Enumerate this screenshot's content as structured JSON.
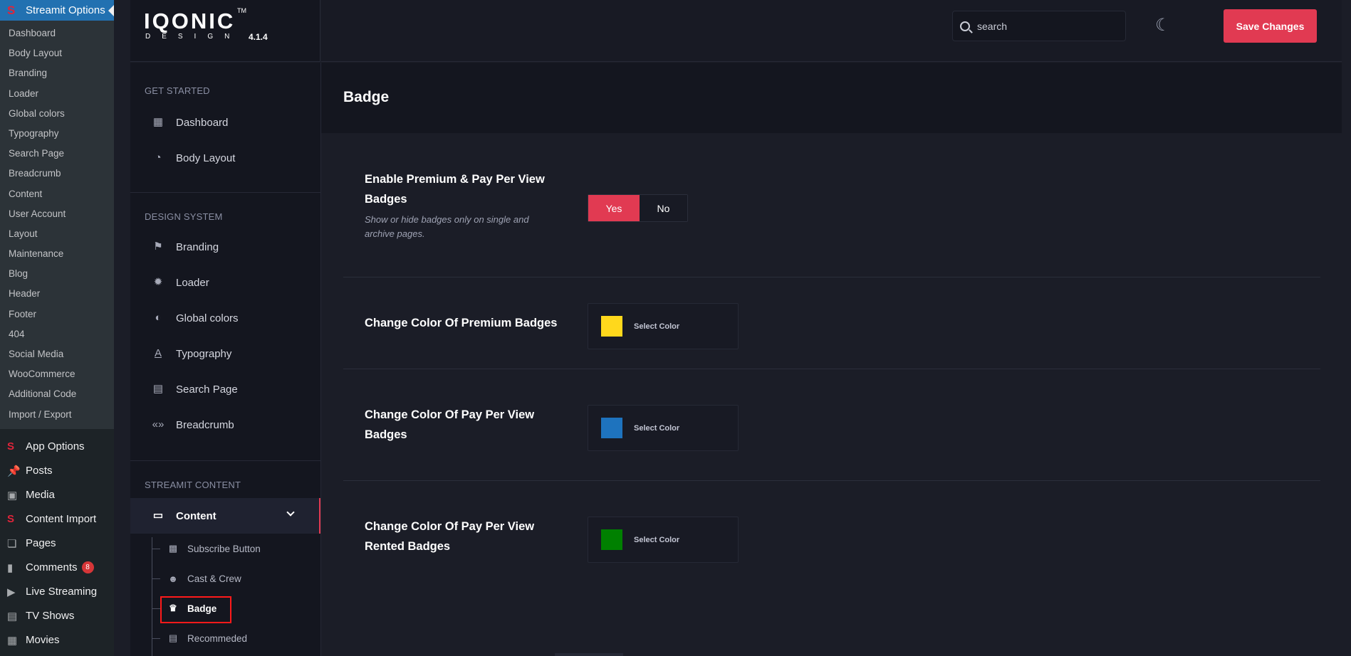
{
  "wp_menu": {
    "active_item": "Streamit Options",
    "submenu": [
      "Dashboard",
      "Body Layout",
      "Branding",
      "Loader",
      "Global colors",
      "Typography",
      "Search Page",
      "Breadcrumb",
      "Content",
      "User Account",
      "Layout",
      "Maintenance",
      "Blog",
      "Header",
      "Footer",
      "404",
      "Social Media",
      "WooCommerce",
      "Additional Code",
      "Import / Export"
    ],
    "top_items": [
      {
        "label": "App Options",
        "icon": "streamit-s-icon"
      },
      {
        "label": "Posts",
        "icon": "pin-icon"
      },
      {
        "label": "Media",
        "icon": "media-icon"
      },
      {
        "label": "Content Import",
        "icon": "streamit-s-icon"
      },
      {
        "label": "Pages",
        "icon": "pages-icon"
      },
      {
        "label": "Comments",
        "icon": "comment-icon",
        "badge": "8"
      },
      {
        "label": "Live Streaming",
        "icon": "play-icon"
      },
      {
        "label": "TV Shows",
        "icon": "tv-icon"
      },
      {
        "label": "Movies",
        "icon": "film-icon"
      }
    ]
  },
  "logo": {
    "main": "IQONIC",
    "tm": "TM",
    "sub": "DESIGN",
    "version": "4.1.4"
  },
  "topbar": {
    "search_placeholder": "search",
    "save_label": "Save Changes"
  },
  "panel_nav": {
    "sections": [
      {
        "title": "GET STARTED",
        "items": [
          {
            "label": "Dashboard",
            "icon": "grid-icon"
          },
          {
            "label": "Body Layout",
            "icon": "gauge-icon"
          }
        ]
      },
      {
        "title": "DESIGN SYSTEM",
        "items": [
          {
            "label": "Branding",
            "icon": "flag-icon"
          },
          {
            "label": "Loader",
            "icon": "loader-icon"
          },
          {
            "label": "Global colors",
            "icon": "droplet-icon"
          },
          {
            "label": "Typography",
            "icon": "typography-icon"
          },
          {
            "label": "Search Page",
            "icon": "document-icon"
          },
          {
            "label": "Breadcrumb",
            "icon": "breadcrumb-icon"
          }
        ]
      },
      {
        "title": "STREAMIT CONTENT",
        "items": [
          {
            "label": "Content",
            "icon": "window-icon"
          }
        ]
      }
    ],
    "content_subitems": [
      {
        "label": "Subscribe Button",
        "icon": "subscribe-icon"
      },
      {
        "label": "Cast & Crew",
        "icon": "people-icon"
      },
      {
        "label": "Badge",
        "icon": "crown-icon"
      },
      {
        "label": "Recommeded",
        "icon": "list-icon"
      }
    ]
  },
  "content": {
    "title": "Badge",
    "rows": [
      {
        "label": "Enable Premium & Pay Per View Badges",
        "description": "Show or hide badges only on single and archive pages.",
        "yes": "Yes",
        "no": "No",
        "selected": "Yes"
      },
      {
        "label": "Change Color Of Premium Badges",
        "picker_label": "Select Color",
        "color": "#ffd81c"
      },
      {
        "label": "Change Color Of Pay Per View Badges",
        "picker_label": "Select Color",
        "color": "#1e73be"
      },
      {
        "label": "Change Color Of Pay Per View Rented Badges",
        "picker_label": "Select Color",
        "color": "#008000"
      }
    ]
  }
}
